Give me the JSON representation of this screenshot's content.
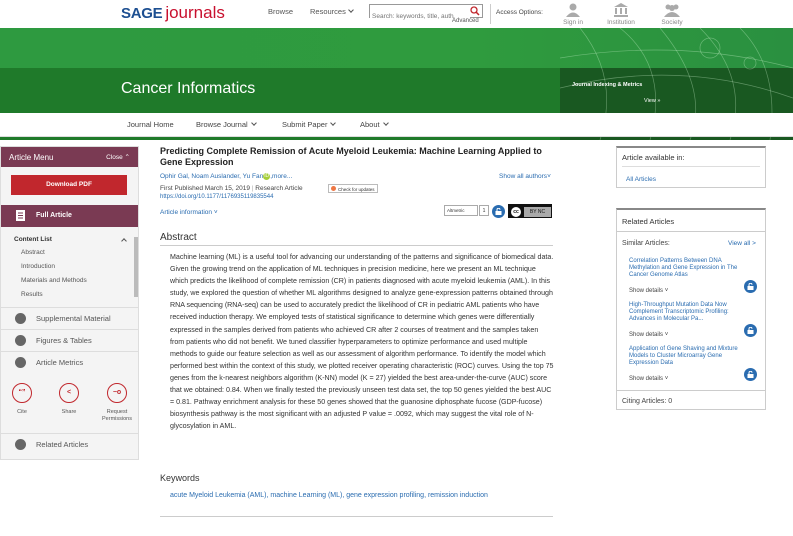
{
  "header": {
    "logo_sage": "SAGE",
    "logo_journals": "journals",
    "browse": "Browse",
    "resources": "Resources",
    "search_placeholder": "Search: keywords, title, auth",
    "advanced": "Advanced",
    "access_options": "Access Options:",
    "sign_in": "Sign in",
    "institution": "Institution",
    "society": "Society"
  },
  "banner": {
    "journal_title": "Cancer Informatics",
    "indexing_link": "Journal Indexing & Metrics",
    "view_link": "View »"
  },
  "subnav": {
    "journal_home": "Journal Home",
    "browse_journal": "Browse Journal",
    "submit_paper": "Submit Paper",
    "about": "About"
  },
  "menu": {
    "title": "Article Menu",
    "close": "Close",
    "download_pdf": "Download PDF",
    "full_article": "Full Article",
    "content_list": "Content List",
    "content_items": [
      "Abstract",
      "Introduction",
      "Materials and Methods",
      "Results"
    ],
    "supplemental": "Supplemental Material",
    "figures": "Figures & Tables",
    "metrics": "Article Metrics",
    "cite": "Cite",
    "share": "Share",
    "request": "Request Permissions",
    "related": "Related Articles"
  },
  "article": {
    "title": "Predicting Complete Remission of Acute Myeloid Leukemia: Machine Learning Applied to Gene Expression",
    "authors": "Ophir Gal, Noam Auslander, Yu Fan",
    "authors_more": ",more...",
    "show_all_authors": "Show all authors",
    "published": "First Published March 15, 2019",
    "type": "Research Article",
    "check_updates": "Check for updates",
    "doi": "https://doi.org/10.1177/1176935119835544",
    "info": "Article information",
    "altmetric": "Altmetric",
    "altmetric_count": "1",
    "cc": "cc",
    "cc_terms": "BY  NC",
    "abstract_heading": "Abstract",
    "abstract_text": "Machine learning (ML) is a useful tool for advancing our understanding of the patterns and significance of biomedical data. Given the growing trend on the application of ML techniques in precision medicine, here we present an ML technique which predicts the likelihood of complete remission (CR) in patients diagnosed with acute myeloid leukemia (AML). In this study, we explored the question of whether ML algorithms designed to analyze gene-expression patterns obtained through RNA sequencing (RNA-seq) can be used to accurately predict the likelihood of CR in pediatric AML patients who have received induction therapy. We employed tests of statistical significance to determine which genes were differentially expressed in the samples derived from patients who achieved CR after 2 courses of treatment and the samples taken from patients who did not benefit. We tuned classifier hyperparameters to optimize performance and used multiple methods to guide our feature selection as well as our assessment of algorithm performance. To identify the model which performed best within the context of this study, we plotted receiver operating characteristic (ROC) curves. Using the top 75 genes from the k-nearest neighbors algorithm (K-NN) model (K = 27) yielded the best area-under-the-curve (AUC) score that we obtained: 0.84. When we finally tested the previously unseen test data set, the top 50 genes yielded the best AUC = 0.81. Pathway enrichment analysis for these 50 genes showed that the guanosine diphosphate fucose (GDP-fucose) biosynthesis pathway is the most significant with an adjusted P value = .0092, which may suggest the vital role of N-glycosylation in AML.",
    "keywords_heading": "Keywords",
    "keywords": "acute Myeloid Leukemia (AML), machine Learning (ML), gene expression profiling, remission induction"
  },
  "sidebar": {
    "available_in": "Article available in:",
    "all_articles": "All Articles",
    "related_heading": "Related Articles",
    "similar": "Similar Articles:",
    "view_all": "View all >",
    "items": [
      {
        "title": "Correlation Patterns Between DNA Methylation and Gene Expression in The Cancer Genome Atlas",
        "detail": "Show details"
      },
      {
        "title": "High-Throughput Mutation Data Now Complement Transcriptomic Profiling: Advances in Molecular Pa...",
        "detail": "Show details"
      },
      {
        "title": "Application of Gene Shaving and Mixture Models to Cluster Microarray Gene Expression Data",
        "detail": "Show details"
      }
    ],
    "citing": "Citing Articles: 0"
  },
  "colors": {
    "brand_blue": "#1d4f91",
    "journal_red": "#c8102e",
    "banner_green": "#2e9a40",
    "menu_maroon": "#7a3a53",
    "pdf_red": "#c1272d",
    "link_blue": "#2a6cb0"
  }
}
